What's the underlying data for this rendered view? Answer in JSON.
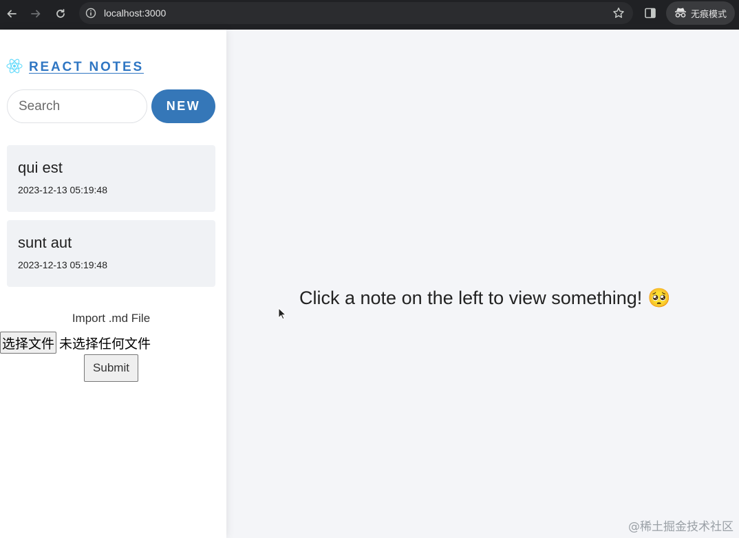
{
  "browser": {
    "url": "localhost:3000",
    "incognito_label": "无痕模式"
  },
  "sidebar": {
    "brand": "REACT NOTES",
    "search_placeholder": "Search",
    "new_label": "NEW",
    "notes": [
      {
        "title": "qui est",
        "date": "2023-12-13 05:19:48"
      },
      {
        "title": "sunt aut",
        "date": "2023-12-13 05:19:48"
      }
    ],
    "import": {
      "label": "Import .md File",
      "choose_file_label": "选择文件",
      "no_file_label": "未选择任何文件",
      "submit_label": "Submit"
    }
  },
  "main": {
    "placeholder": "Click a note on the left to view something!",
    "emoji": "🥺"
  },
  "watermark": "@稀土掘金技术社区",
  "colors": {
    "accent": "#3577b8",
    "brand_text": "#2f76c3",
    "chrome_bg": "#202124",
    "main_bg": "#f4f5f8"
  }
}
